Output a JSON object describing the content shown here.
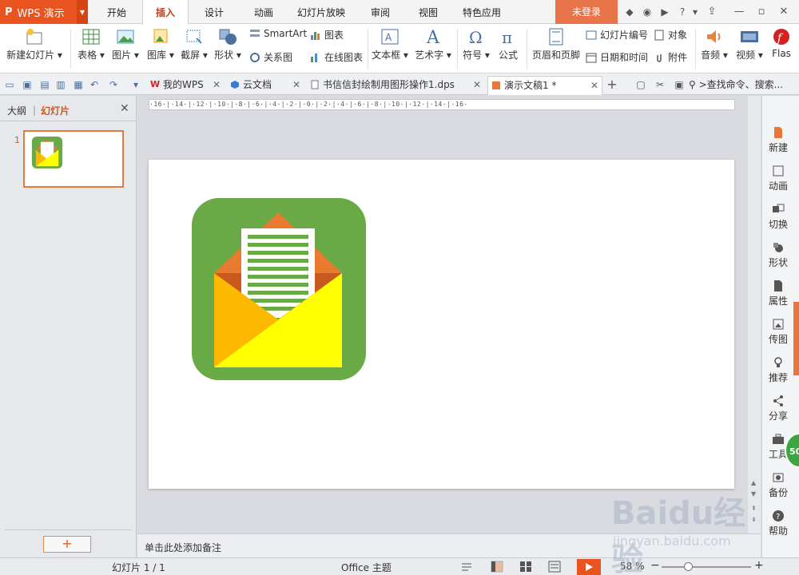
{
  "app": {
    "logo": "P",
    "name": "WPS 演示"
  },
  "menu_tabs": [
    "开始",
    "插入",
    "设计",
    "动画",
    "幻灯片放映",
    "审阅",
    "视图",
    "特色应用"
  ],
  "active_menu_tab": "插入",
  "login_label": "未登录",
  "ribbon": {
    "new_slide": "新建幻灯片",
    "table": "表格",
    "picture": "图片",
    "gallery": "图库",
    "screenshot": "截屏",
    "shape": "形状",
    "smartart": "SmartArt",
    "chart": "图表",
    "relation": "关系图",
    "online_chart": "在线图表",
    "textbox": "文本框",
    "wordart": "艺术字",
    "symbol": "符号",
    "formula": "公式",
    "header_footer": "页眉和页脚",
    "slide_number": "幻灯片编号",
    "object": "对象",
    "date_time": "日期和时间",
    "attachment": "附件",
    "audio": "音频",
    "video": "视频",
    "flash": "Flas"
  },
  "doc_tabs": [
    {
      "label": "我的WPS"
    },
    {
      "label": "云文档"
    },
    {
      "label": "书信信封绘制用图形操作1.dps"
    },
    {
      "label": "演示文稿1 *"
    }
  ],
  "search_placeholder": ">查找命令、搜索...",
  "left_panel": {
    "outline_tab": "大纲",
    "divider": "|",
    "slides_tab": "幻灯片",
    "slide_number": "1"
  },
  "notes_placeholder": "单击此处添加备注",
  "right_bar": [
    "新建",
    "动画",
    "切换",
    "形状",
    "属性",
    "传图",
    "推荐",
    "分享",
    "工具",
    "备份",
    "帮助"
  ],
  "status": {
    "slide": "幻灯片 1 / 1",
    "theme": "Office 主题",
    "zoom": "58 %",
    "zoom_fraction": 0.3
  },
  "ruler_text": "·16·|·14·|·12·|·10·|·8·|·6·|·4·|·2·|·0·|·2·|·4·|·6·|·8·|·10·|·12·|·14·|·16·",
  "watermark": {
    "brand": "Baidu经验",
    "url": "jingyan.baidu.com"
  },
  "floating_badge": "50",
  "colors": {
    "accent": "#e8531f",
    "icon_green": "#6aaa46",
    "envelope_yellow": "#ffff00",
    "envelope_amber": "#fdb900",
    "envelope_orange": "#ea7a2f",
    "letter_line": "#6aaa46"
  }
}
